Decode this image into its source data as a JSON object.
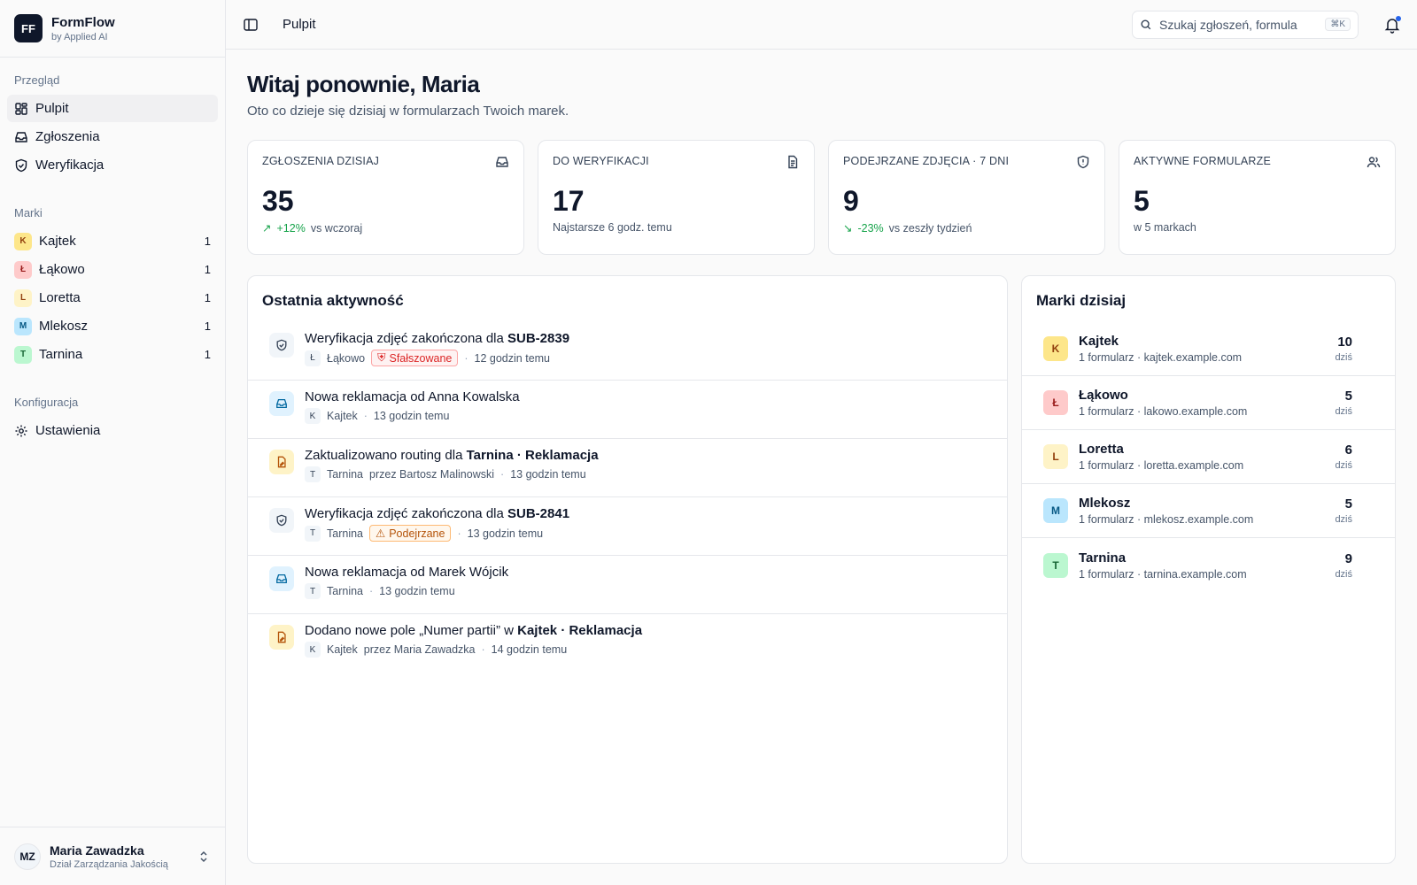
{
  "app": {
    "logo_initials": "FF",
    "name": "FormFlow",
    "subtitle": "by Applied AI"
  },
  "sidebar": {
    "section_overview": "Przegląd",
    "nav": [
      {
        "label": "Pulpit",
        "icon": "dashboard-icon",
        "active": true
      },
      {
        "label": "Zgłoszenia",
        "icon": "inbox-icon"
      },
      {
        "label": "Weryfikacja",
        "icon": "shield-icon"
      }
    ],
    "section_brands": "Marki",
    "brands": [
      {
        "initial": "K",
        "label": "Kajtek",
        "count": "1",
        "bg": "#fde68a",
        "fg": "#92400e"
      },
      {
        "initial": "Ł",
        "label": "Łąkowo",
        "count": "1",
        "bg": "#fecaca",
        "fg": "#991b1b"
      },
      {
        "initial": "L",
        "label": "Loretta",
        "count": "1",
        "bg": "#fef3c7",
        "fg": "#92400e"
      },
      {
        "initial": "M",
        "label": "Mlekosz",
        "count": "1",
        "bg": "#bae6fd",
        "fg": "#075985"
      },
      {
        "initial": "T",
        "label": "Tarnina",
        "count": "1",
        "bg": "#bbf7d0",
        "fg": "#166534"
      }
    ],
    "section_config": "Konfiguracja",
    "settings_label": "Ustawienia"
  },
  "user": {
    "initials": "MZ",
    "name": "Maria Zawadzka",
    "department": "Dział Zarządzania Jakością"
  },
  "topbar": {
    "breadcrumb": "Pulpit",
    "search_placeholder": "Szukaj zgłoszeń, formula",
    "search_shortcut": "⌘K"
  },
  "header": {
    "greeting": "Witaj ponownie, Maria",
    "subtitle": "Oto co dzieje się dzisiaj w formularzach Twoich marek."
  },
  "stats": [
    {
      "label": "Zgłoszenia dzisiaj",
      "value": "35",
      "delta": "+12%",
      "foot": "vs wczoraj",
      "icon": "inbox-icon"
    },
    {
      "label": "Do weryfikacji",
      "value": "17",
      "delta": "",
      "foot": "Najstarsze 6 godz. temu",
      "icon": "document-icon"
    },
    {
      "label": "Podejrzane zdjęcia · 7 dni",
      "value": "9",
      "delta": "-23%",
      "foot": "vs zeszły tydzień",
      "icon": "shield-alert-icon"
    },
    {
      "label": "Aktywne formularze",
      "value": "5",
      "delta": "",
      "foot": "w 5 markach",
      "icon": "users-icon"
    }
  ],
  "activity": {
    "title": "Ostatnia aktywność",
    "items": [
      {
        "type": "verify",
        "title_pre": "Weryfikacja zdjęć zakończona dla ",
        "title_bold": "SUB-2839",
        "title_post": "",
        "brand_initial": "Ł",
        "brand": "Łąkowo",
        "tag": "Sfałszowane",
        "tag_style": "red",
        "by": "",
        "time": "12 godzin temu"
      },
      {
        "type": "inbox",
        "title_pre": "Nowa reklamacja od Anna Kowalska",
        "title_bold": "",
        "title_post": "",
        "brand_initial": "K",
        "brand": "Kajtek",
        "tag": "",
        "tag_style": "",
        "by": "",
        "time": "13 godzin temu"
      },
      {
        "type": "form",
        "title_pre": "Zaktualizowano routing dla ",
        "title_bold": "Tarnina · Reklamacja",
        "title_post": "",
        "brand_initial": "T",
        "brand": "Tarnina",
        "tag": "",
        "tag_style": "",
        "by": "przez Bartosz Malinowski",
        "time": "13 godzin temu"
      },
      {
        "type": "verify",
        "title_pre": "Weryfikacja zdjęć zakończona dla ",
        "title_bold": "SUB-2841",
        "title_post": "",
        "brand_initial": "T",
        "brand": "Tarnina",
        "tag": "Podejrzane",
        "tag_style": "amber",
        "by": "",
        "time": "13 godzin temu"
      },
      {
        "type": "inbox",
        "title_pre": "Nowa reklamacja od Marek Wójcik",
        "title_bold": "",
        "title_post": "",
        "brand_initial": "T",
        "brand": "Tarnina",
        "tag": "",
        "tag_style": "",
        "by": "",
        "time": "13 godzin temu"
      },
      {
        "type": "form",
        "title_pre": "Dodano nowe pole „Numer partii” w ",
        "title_bold": "Kajtek · Reklamacja",
        "title_post": "",
        "brand_initial": "K",
        "brand": "Kajtek",
        "tag": "",
        "tag_style": "",
        "by": "przez Maria Zawadzka",
        "time": "14 godzin temu"
      }
    ]
  },
  "brands_today": {
    "title": "Marki dzisiaj",
    "unit": "dziś",
    "items": [
      {
        "initial": "K",
        "name": "Kajtek",
        "meta": "1 formularz · kajtek.example.com",
        "count": "10",
        "bg": "#fde68a",
        "fg": "#92400e"
      },
      {
        "initial": "Ł",
        "name": "Łąkowo",
        "meta": "1 formularz · lakowo.example.com",
        "count": "5",
        "bg": "#fecaca",
        "fg": "#991b1b"
      },
      {
        "initial": "L",
        "name": "Loretta",
        "meta": "1 formularz · loretta.example.com",
        "count": "6",
        "bg": "#fef3c7",
        "fg": "#92400e"
      },
      {
        "initial": "M",
        "name": "Mlekosz",
        "meta": "1 formularz · mlekosz.example.com",
        "count": "5",
        "bg": "#bae6fd",
        "fg": "#075985"
      },
      {
        "initial": "T",
        "name": "Tarnina",
        "meta": "1 formularz · tarnina.example.com",
        "count": "9",
        "bg": "#bbf7d0",
        "fg": "#166534"
      }
    ]
  },
  "colors": {
    "positive": "#16a34a",
    "danger": "#dc2626",
    "warning": "#b45309",
    "verify_icon_bg": "#f1f5f9",
    "inbox_icon_bg": "#e0f2fe",
    "form_icon_bg": "#fef3c7"
  }
}
